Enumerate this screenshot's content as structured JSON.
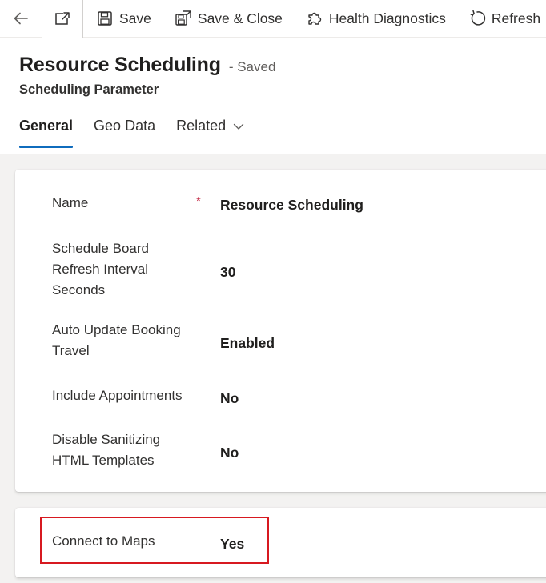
{
  "toolbar": {
    "back_icon": "back-arrow-icon",
    "popout_icon": "open-in-new-window-icon",
    "save_label": "Save",
    "save_close_label": "Save & Close",
    "health_label": "Health Diagnostics",
    "refresh_label": "Refresh"
  },
  "header": {
    "title": "Resource Scheduling",
    "status": "- Saved",
    "entity": "Scheduling Parameter"
  },
  "tabs": [
    {
      "label": "General",
      "active": true
    },
    {
      "label": "Geo Data",
      "active": false
    },
    {
      "label": "Related",
      "active": false
    }
  ],
  "form": {
    "fields": [
      {
        "label": "Name",
        "required_mark": "*",
        "value": "Resource Scheduling"
      },
      {
        "label": "Schedule Board Refresh Interval Seconds",
        "value": "30"
      },
      {
        "label": "Auto Update Booking Travel",
        "value": "Enabled"
      },
      {
        "label": "Include Appointments",
        "value": "No"
      },
      {
        "label": "Disable Sanitizing HTML Templates",
        "value": "No"
      }
    ],
    "maps_field": {
      "label": "Connect to Maps",
      "value": "Yes"
    }
  },
  "colors": {
    "accent": "#0f6cbd",
    "required": "#c4314b",
    "highlight": "#d71920"
  }
}
